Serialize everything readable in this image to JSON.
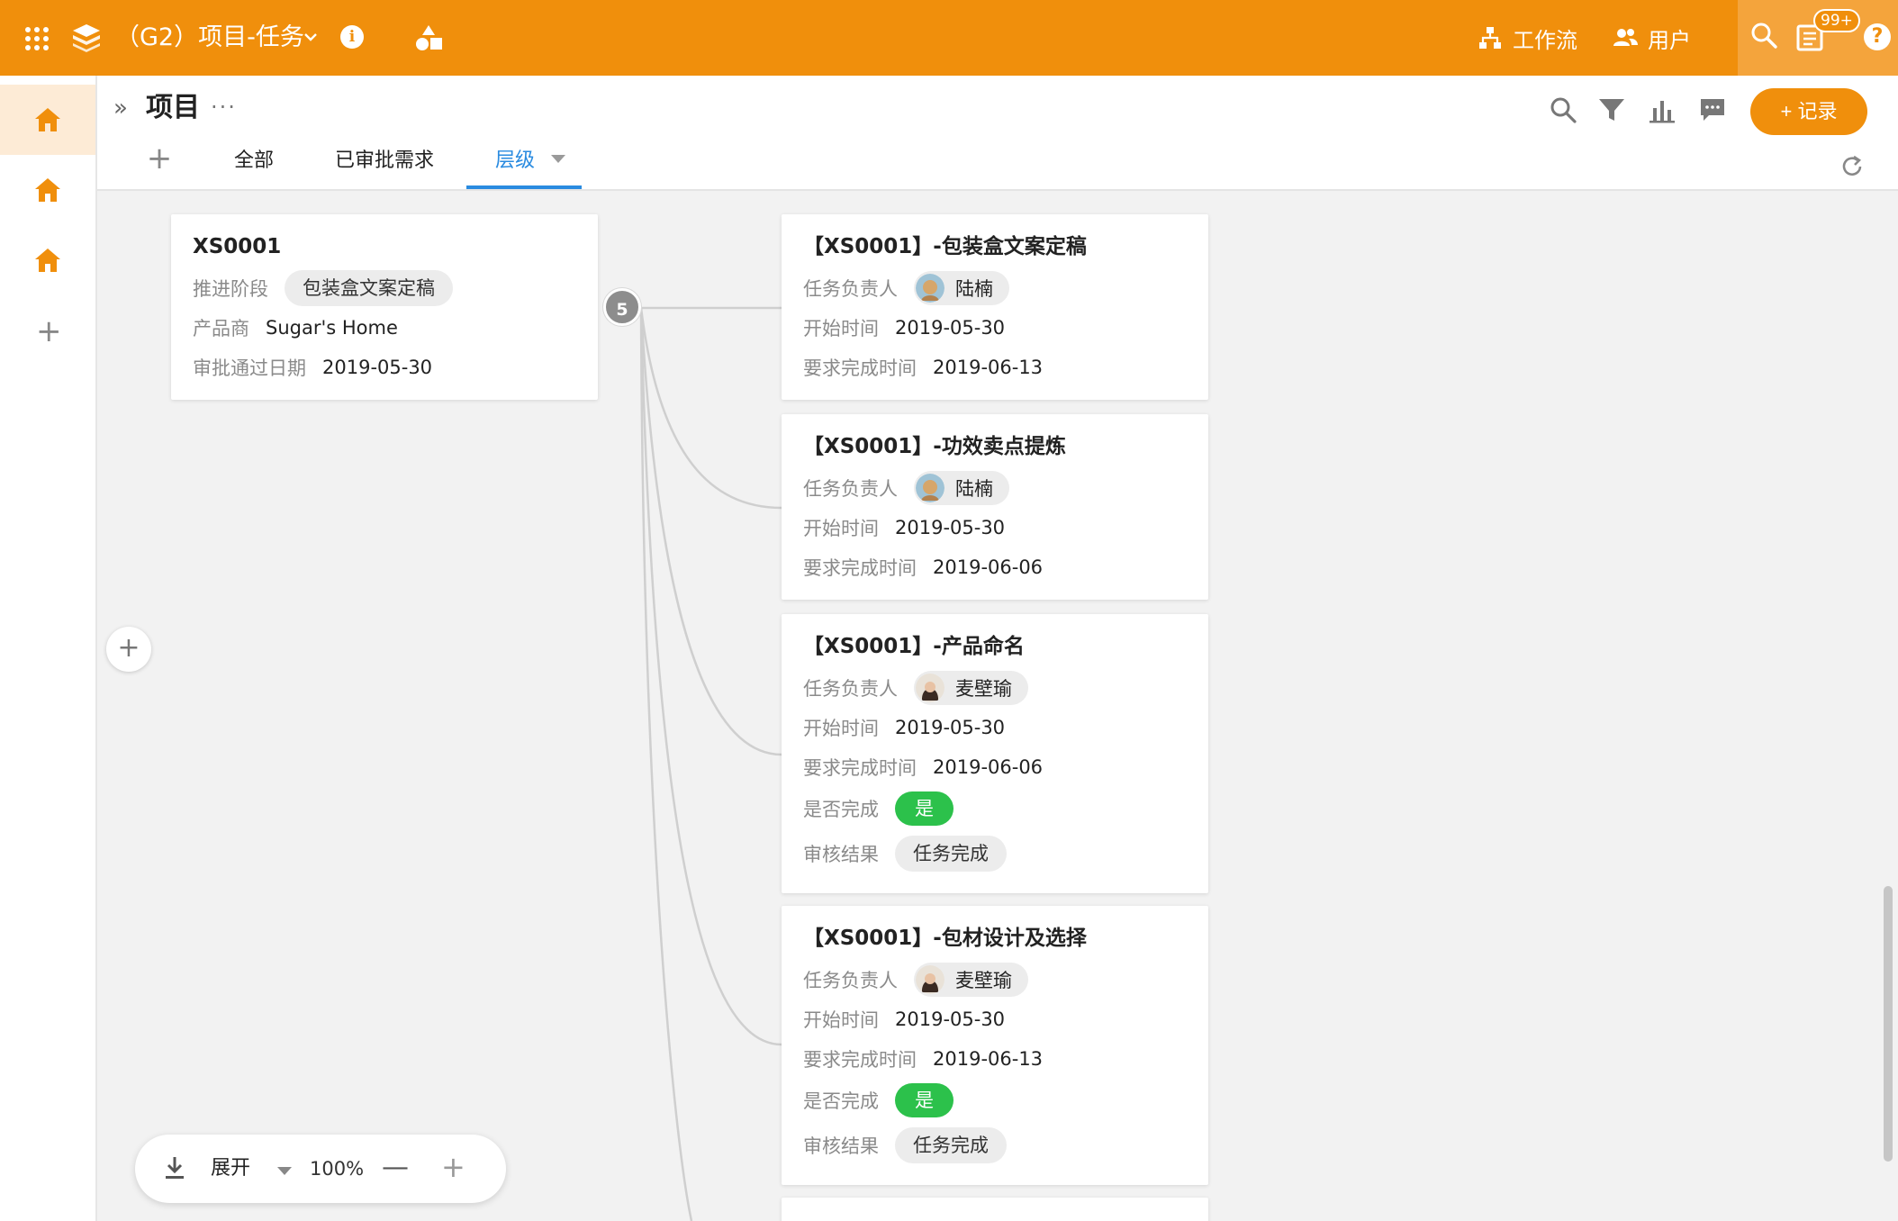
{
  "topbar": {
    "app_title": "（G2）项目-任务",
    "workflow_label": "工作流",
    "users_label": "用户",
    "notification_badge": "99+",
    "help_label": "?",
    "info_label": "i"
  },
  "header": {
    "expand_icon": "»",
    "page_title": "项目",
    "more_icon": "···",
    "add_record_label": "+ 记录",
    "tab_add": "+",
    "tabs": [
      {
        "label": "全部"
      },
      {
        "label": "已审批需求"
      },
      {
        "label": "层级"
      }
    ]
  },
  "rail": {
    "add_label": "+"
  },
  "tree": {
    "child_count": "5",
    "parent": {
      "title": "XS0001",
      "stage_label": "推进阶段",
      "stage_value": "包装盒文案定稿",
      "vendor_label": "产品商",
      "vendor_value": "Sugar's Home",
      "approve_label": "审批通过日期",
      "approve_value": "2019-05-30"
    },
    "tasks": [
      {
        "title": "【XS0001】-包装盒文案定稿",
        "owner_label": "任务负责人",
        "owner": "陆楠",
        "start_label": "开始时间",
        "start": "2019-05-30",
        "due_label": "要求完成时间",
        "due": "2019-06-13"
      },
      {
        "title": "【XS0001】-功效卖点提炼",
        "owner_label": "任务负责人",
        "owner": "陆楠",
        "start_label": "开始时间",
        "start": "2019-05-30",
        "due_label": "要求完成时间",
        "due": "2019-06-06"
      },
      {
        "title": "【XS0001】-产品命名",
        "owner_label": "任务负责人",
        "owner": "麦壁瑜",
        "start_label": "开始时间",
        "start": "2019-05-30",
        "due_label": "要求完成时间",
        "due": "2019-06-06",
        "done_label": "是否完成",
        "done": "是",
        "review_label": "审核结果",
        "review": "任务完成"
      },
      {
        "title": "【XS0001】-包材设计及选择",
        "owner_label": "任务负责人",
        "owner": "麦壁瑜",
        "start_label": "开始时间",
        "start": "2019-05-30",
        "due_label": "要求完成时间",
        "due": "2019-06-13",
        "done_label": "是否完成",
        "done": "是",
        "review_label": "审核结果",
        "review": "任务完成"
      }
    ]
  },
  "zoombar": {
    "mode_label": "展开",
    "zoom_level": "100%",
    "minus_label": "—",
    "plus_label": "+"
  },
  "side_add_label": "+",
  "colors": {
    "brand": "#f08f0c",
    "accent_tab": "#2a8be0",
    "done_green": "#2cc14b"
  }
}
